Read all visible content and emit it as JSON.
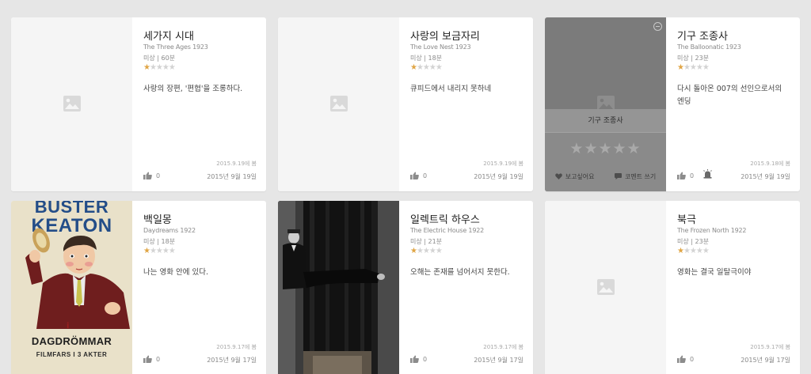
{
  "colors": {
    "background": "#e6e6e6",
    "star_on": "#e0a545",
    "star_off": "#d3d3d3"
  },
  "cards": [
    {
      "title": "세가지 시대",
      "original": "The Three Ages 1923",
      "meta": "미상 | 60분",
      "rating_stars": 0.5,
      "comment_line1": "사랑의 장편, '편협'을 조롱하다.",
      "comment_line2": "",
      "watched": "2015.9.19에 봄",
      "likes": "0",
      "date": "2015년 9월 19일",
      "poster": "placeholder-image-icon"
    },
    {
      "title": "사랑의 보금자리",
      "original": "The Love Nest 1923",
      "meta": "미상 | 18분",
      "rating_stars": 0.5,
      "comment_line1": "큐피드에서 내리지 못하네",
      "comment_line2": "",
      "watched": "2015.9.19에 봄",
      "likes": "0",
      "date": "2015년 9월 19일",
      "poster": "placeholder-image-icon"
    },
    {
      "title": "기구 조종사",
      "original": "The Balloonatic 1923",
      "meta": "미상 | 23분",
      "rating_stars": 0.5,
      "comment_line1": "다시 돌아온 007의 선인으로서의",
      "comment_line2": "엔딩",
      "watched": "2015.9.18에 봄",
      "likes": "0",
      "date": "2015년 9월 19일",
      "poster": "placeholder-image-icon",
      "overlay": {
        "title": "기구 조종사",
        "wish_label": "보고싶어요",
        "comment_label": "코멘트 쓰기",
        "icons": [
          "minus-circle-icon",
          "heart-icon",
          "speech-bubble-icon",
          "alert-icon"
        ]
      }
    },
    {
      "title": "백일몽",
      "original": "Daydreams 1922",
      "meta": "미상 | 18분",
      "rating_stars": 0.5,
      "comment_line1": "나는 영화 안에 있다.",
      "comment_line2": "",
      "watched": "2015.9.17에 봄",
      "likes": "0",
      "date": "2015년 9월 17일",
      "poster_text": {
        "line1": "BUSTER",
        "line2": "KEATON",
        "small": "i",
        "big": "DAGDRÖMMAR",
        "sub": "FILMFARS I 3 AKTER"
      }
    },
    {
      "title": "일렉트릭 하우스",
      "original": "The Electric House 1922",
      "meta": "미상 | 21분",
      "rating_stars": 0.5,
      "comment_line1": "오해는 존재를 넘어서지 못한다.",
      "comment_line2": "",
      "watched": "2015.9.17에 봄",
      "likes": "0",
      "date": "2015년 9월 17일",
      "poster": "photo"
    },
    {
      "title": "북극",
      "original": "The Frozen North 1922",
      "meta": "미상 | 23분",
      "rating_stars": 0.5,
      "comment_line1": "영화는 결국 일탈극이야",
      "comment_line2": "",
      "watched": "2015.9.17에 봄",
      "likes": "0",
      "date": "2015년 9월 17일",
      "poster": "placeholder-image-icon"
    }
  ]
}
